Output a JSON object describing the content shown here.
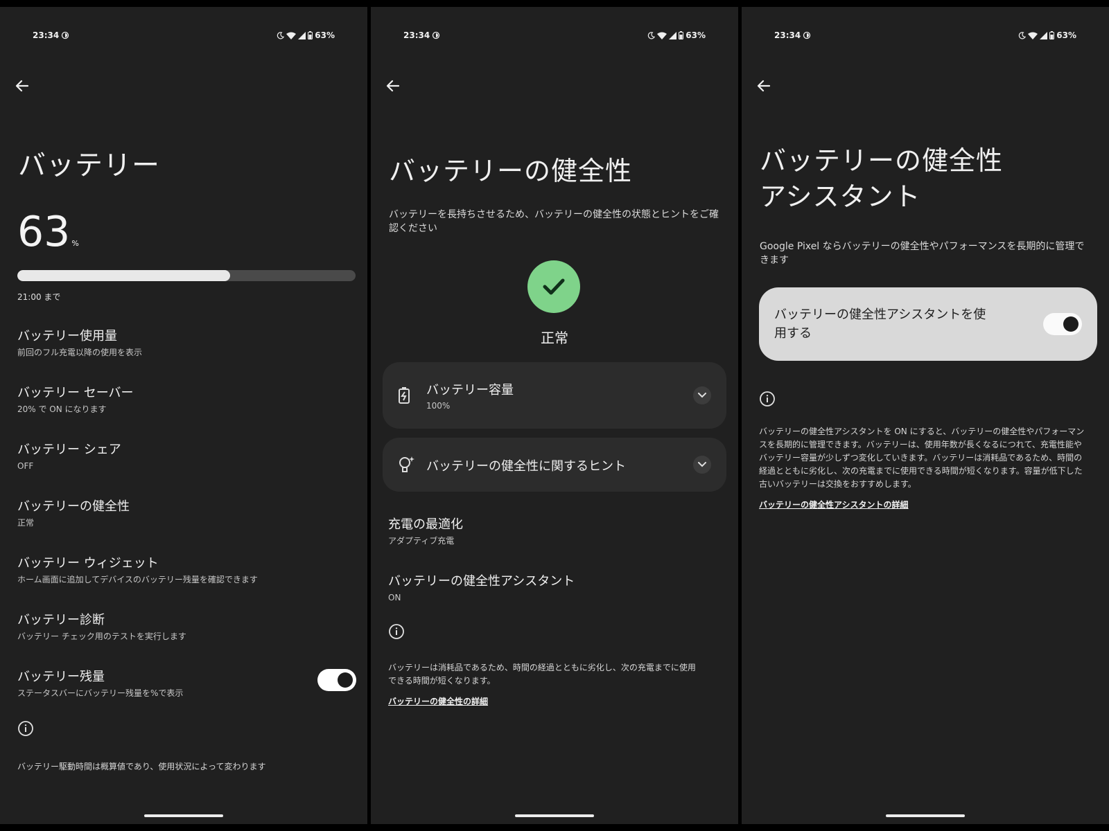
{
  "status_bar": {
    "time": "23:34",
    "battery_pct": "63%"
  },
  "panel1": {
    "title": "バッテリー",
    "level_number": "63",
    "level_unit": "%",
    "level_fraction": 0.63,
    "until": "21:00 まで",
    "items": [
      {
        "title": "バッテリー使用量",
        "subtitle": "前回のフル充電以降の使用を表示"
      },
      {
        "title": "バッテリー セーバー",
        "subtitle": "20% で ON になります"
      },
      {
        "title": "バッテリー シェア",
        "subtitle": "OFF"
      },
      {
        "title": "バッテリーの健全性",
        "subtitle": "正常"
      },
      {
        "title": "バッテリー ウィジェット",
        "subtitle": "ホーム画面に追加してデバイスのバッテリー残量を確認できます"
      },
      {
        "title": "バッテリー診断",
        "subtitle": "バッテリー チェック用のテストを実行します"
      },
      {
        "title": "バッテリー残量",
        "subtitle": "ステータスバーにバッテリー残量を%で表示",
        "toggle_on": true
      }
    ],
    "footer": "バッテリー駆動時間は概算値であり、使用状況によって変わります"
  },
  "panel2": {
    "title": "バッテリーの健全性",
    "description": "バッテリーを長持ちさせるため、バッテリーの健全性の状態とヒントをご確認ください",
    "status_label": "正常",
    "capacity_card": {
      "title": "バッテリー容量",
      "value": "100%"
    },
    "tips_card": {
      "title": "バッテリーの健全性に関するヒント"
    },
    "items": [
      {
        "title": "充電の最適化",
        "subtitle": "アダプティブ充電"
      },
      {
        "title": "バッテリーの健全性アシスタント",
        "subtitle": "ON"
      }
    ],
    "footer": "バッテリーは消耗品であるため、時間の経過とともに劣化し、次の充電までに使用できる時間が短くなります。",
    "link": "バッテリーの健全性の詳細"
  },
  "panel3": {
    "title_line1": "バッテリーの健全性",
    "title_line2": "アシスタント",
    "description": "Google Pixel ならバッテリーの健全性やパフォーマンスを長期的に管理できます",
    "toggle_label": "バッテリーの健全性アシスタントを使用する",
    "toggle_on": true,
    "footer": "バッテリーの健全性アシスタントを ON にすると、バッテリーの健全性やパフォーマンスを長期的に管理できます。バッテリーは、使用年数が長くなるにつれて、充電性能やバッテリー容量が少しずつ変化していきます。バッテリーは消耗品であるため、時間の経過とともに劣化し、次の充電までに使用できる時間が短くなります。容量が低下した古いバッテリーは交換をおすすめします。",
    "link": "バッテリーの健全性アシスタントの詳細"
  }
}
